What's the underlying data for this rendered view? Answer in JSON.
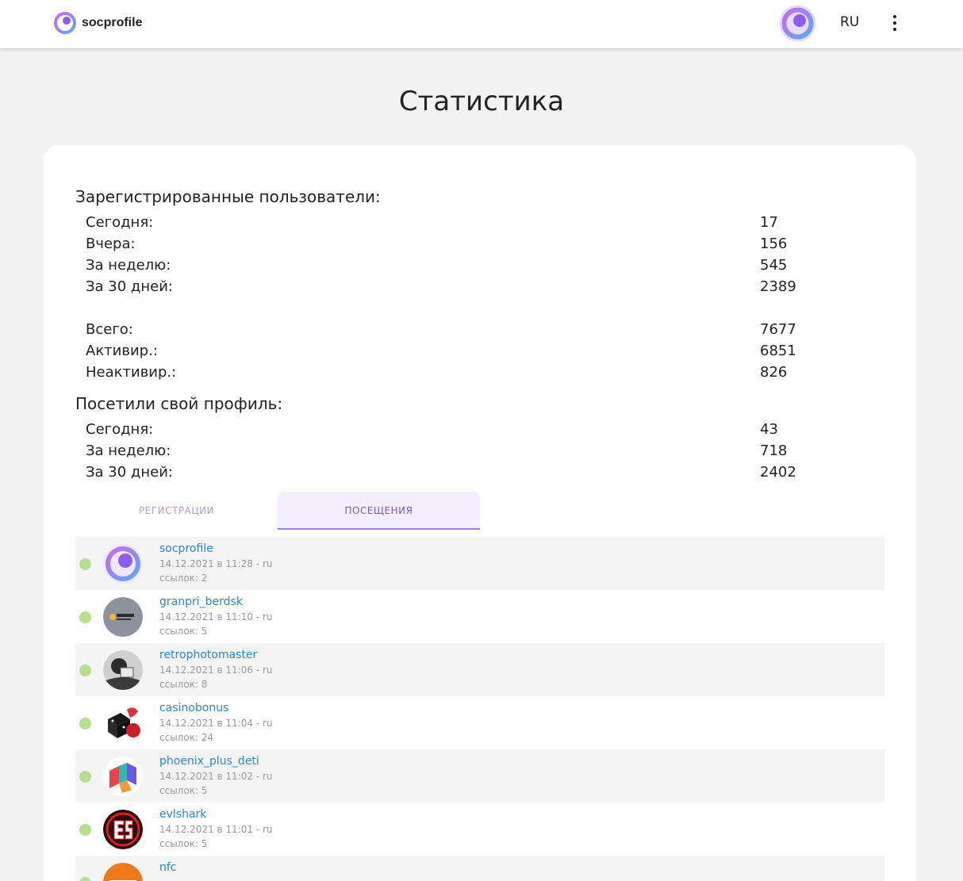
{
  "header": {
    "logo_text": "socprofile",
    "language": "RU"
  },
  "page": {
    "title": "Статистика"
  },
  "registered": {
    "title": "Зарегистрированные пользователи:",
    "rows": [
      {
        "label": "Сегодня:",
        "value": "17"
      },
      {
        "label": "Вчера:",
        "value": "156"
      },
      {
        "label": "За неделю:",
        "value": "545"
      },
      {
        "label": "За 30 дней:",
        "value": "2389"
      },
      {
        "label": "Всего:",
        "value": "7677"
      },
      {
        "label": "Активир.:",
        "value": "6851"
      },
      {
        "label": "Неактивир.:",
        "value": "826"
      }
    ]
  },
  "visited": {
    "title": "Посетили свой профиль:",
    "rows": [
      {
        "label": "Сегодня:",
        "value": "43"
      },
      {
        "label": "За неделю:",
        "value": "718"
      },
      {
        "label": "За 30 дней:",
        "value": "2402"
      }
    ]
  },
  "tabs": [
    {
      "label": "РЕГИСТРАЦИИ",
      "active": false
    },
    {
      "label": "ПОСЕЩЕНИЯ",
      "active": true
    }
  ],
  "visits": [
    {
      "name": "socprofile",
      "date": "14.12.2021 в 11:28 - ru",
      "links": "ссылок: 2",
      "avatar": "socprofile-logo-icon"
    },
    {
      "name": "granpri_berdsk",
      "date": "14.12.2021 в 11:10 - ru",
      "links": "ссылок: 5",
      "avatar": "granpri-avatar"
    },
    {
      "name": "retrophotomaster",
      "date": "14.12.2021 в 11:06 - ru",
      "links": "ссылок: 8",
      "avatar": "retrophoto-avatar"
    },
    {
      "name": "casinobonus",
      "date": "14.12.2021 в 11:04 - ru",
      "links": "ссылок: 24",
      "avatar": "casino-dice-avatar"
    },
    {
      "name": "phoenix_plus_deti",
      "date": "14.12.2021 в 11:02 - ru",
      "links": "ссылок: 5",
      "avatar": "phoenix-avatar"
    },
    {
      "name": "evlshark",
      "date": "14.12.2021 в 11:01 - ru",
      "links": "ссылок: 5",
      "avatar": "evlshark-avatar"
    },
    {
      "name": "nfc",
      "date": "",
      "links": "",
      "avatar": "nfc-avatar"
    }
  ],
  "colors": {
    "accent": "#a07fd6",
    "link": "#2b86c7",
    "online_dot": "#b6de8c"
  }
}
